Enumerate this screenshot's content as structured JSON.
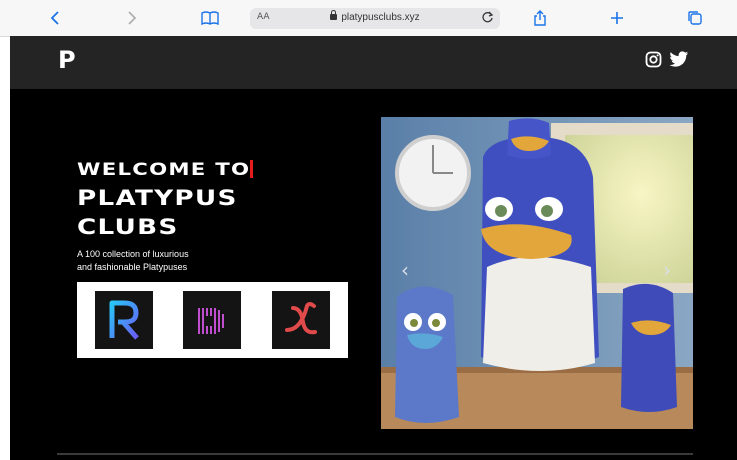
{
  "browser": {
    "reader_label": "AA",
    "url": "platypusclubs.xyz"
  },
  "site": {
    "logo": "P",
    "social": [
      "instagram-icon",
      "twitter-icon"
    ],
    "hero": {
      "line1": "WELCOME TO",
      "line2": "PLATYPUS",
      "line3": "CLUBS",
      "description_line1": "A 100 collection of luxurious",
      "description_line2": "and fashionable Platypuses"
    },
    "partners": [
      "R",
      "d",
      "X"
    ],
    "carousel": {
      "prev": "‹",
      "next": "›"
    }
  },
  "colors": {
    "page_bg": "#000000",
    "header_bg": "#242424",
    "accent_cursor": "#e21b1b",
    "partner_x": "#e04a4a",
    "partner_d": "#c04fd0"
  }
}
